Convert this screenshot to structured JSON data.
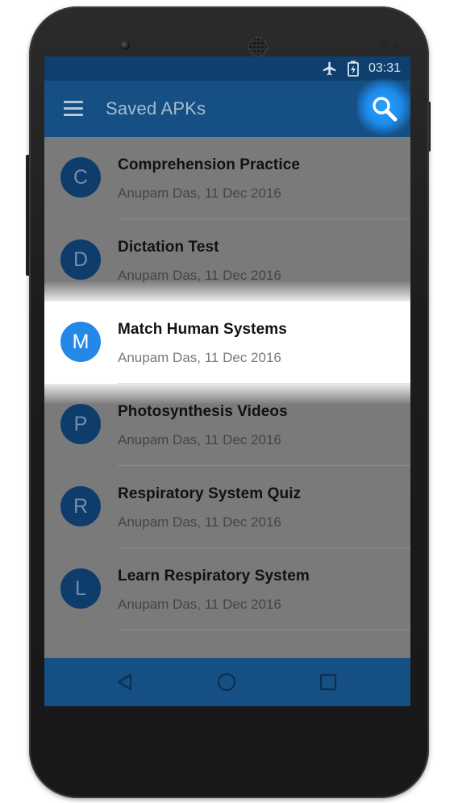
{
  "status_bar": {
    "time": "03:31",
    "icons": [
      "airplane-mode-icon",
      "battery-charging-icon"
    ]
  },
  "app_bar": {
    "title": "Saved APKs",
    "menu_icon": "hamburger-menu-icon",
    "search_icon": "search-icon"
  },
  "apk_list": [
    {
      "initial": "C",
      "title": "Comprehension Practice",
      "meta": "Anupam Das, 11 Dec 2016"
    },
    {
      "initial": "D",
      "title": "Dictation Test",
      "meta": "Anupam Das, 11 Dec 2016"
    },
    {
      "initial": "M",
      "title": "Match Human Systems",
      "meta": "Anupam Das, 11 Dec 2016",
      "highlighted": true
    },
    {
      "initial": "P",
      "title": "Photosynthesis Videos",
      "meta": "Anupam Das, 11 Dec 2016"
    },
    {
      "initial": "R",
      "title": "Respiratory System Quiz",
      "meta": "Anupam Das, 11 Dec 2016"
    },
    {
      "initial": "L",
      "title": "Learn Respiratory System",
      "meta": "Anupam Das, 11 Dec 2016"
    }
  ],
  "nav_bar": {
    "icons": [
      "back-icon",
      "home-icon",
      "recent-apps-icon"
    ]
  },
  "colors": {
    "primary": "#154f84",
    "primary_dark": "#0e3f6e",
    "accent": "#2488e6",
    "scrim": "#7a7a7a"
  }
}
